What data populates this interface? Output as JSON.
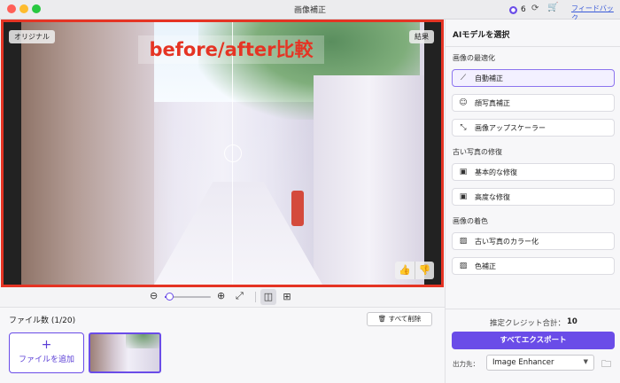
{
  "window": {
    "title": "画像補正"
  },
  "header": {
    "credits": "6",
    "feedback": "フィードバック"
  },
  "preview": {
    "left_label": "オリジナル",
    "right_label": "結果",
    "overlay_text": "before/after比較"
  },
  "zoom": {
    "level_fraction": 0.1
  },
  "files": {
    "count_label": "ファイル数 (1/20)",
    "delete_all": "すべて削除",
    "add_plus": "+",
    "add_label": "ファイルを追加"
  },
  "panel": {
    "title": "AIモデルを選択",
    "sections": [
      {
        "title": "画像の最適化",
        "options": [
          "自動補正",
          "顔写真補正",
          "画像アップスケーラー"
        ]
      },
      {
        "title": "古い写真の修復",
        "options": [
          "基本的な修復",
          "高度な修復"
        ]
      },
      {
        "title": "画像の着色",
        "options": [
          "古い写真のカラー化",
          "色補正"
        ]
      }
    ],
    "selected_option": "自動補正",
    "estimate_label": "推定クレジット合計：",
    "estimate_value": "10",
    "export_label": "すべてエクスポート",
    "output_label": "出力先：",
    "output_value": "Image Enhancer"
  },
  "colors": {
    "accent": "#6a4ce8",
    "highlight_border": "#e53424"
  }
}
